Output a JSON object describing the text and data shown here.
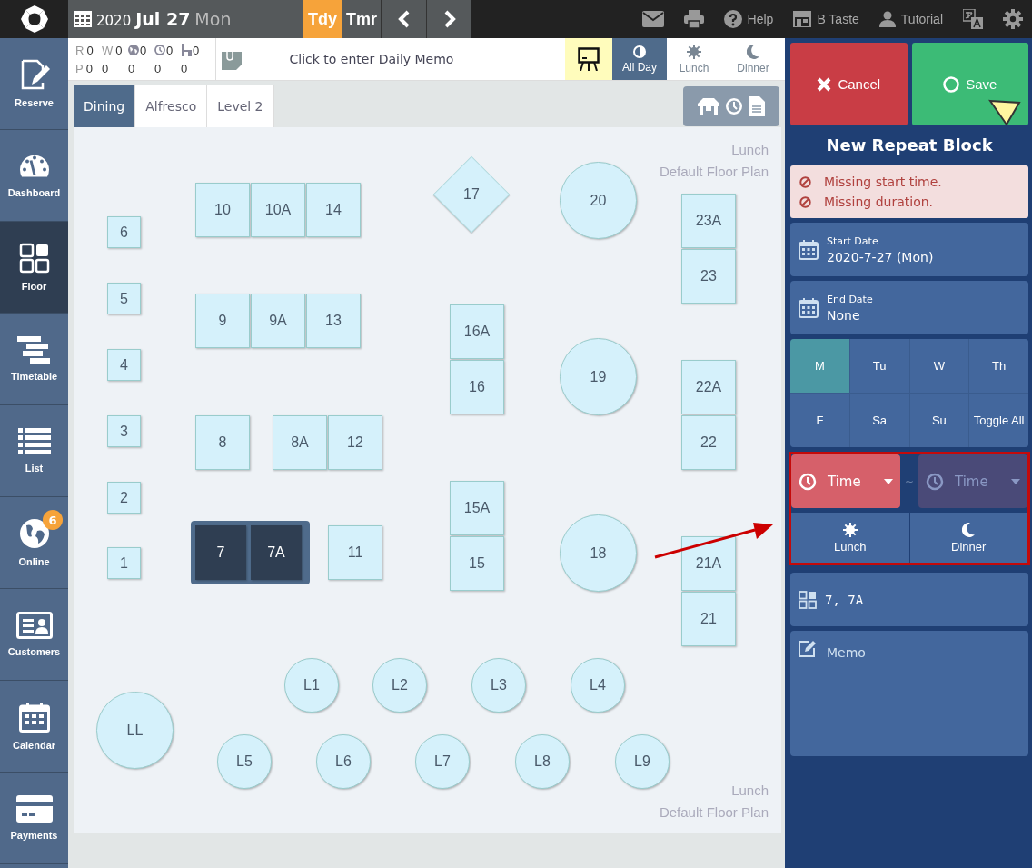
{
  "topbar": {
    "year": "2020",
    "date": "Jul 27",
    "weekday": "Mon",
    "day_buttons": [
      {
        "label": "Tdy",
        "selected": true
      },
      {
        "label": "Tmr",
        "selected": false
      }
    ],
    "links": [
      {
        "kind": "mail"
      },
      {
        "kind": "print"
      },
      {
        "kind": "help",
        "label": "Help"
      },
      {
        "kind": "store",
        "label": "B Taste"
      },
      {
        "kind": "person",
        "label": "Tutorial"
      },
      {
        "kind": "translate"
      },
      {
        "kind": "settings"
      }
    ]
  },
  "sidebar": {
    "items": [
      {
        "kind": "reserve",
        "label": "Reserve",
        "selected": false
      },
      {
        "kind": "dashboard",
        "label": "Dashboard",
        "selected": false
      },
      {
        "kind": "floor",
        "label": "Floor",
        "selected": true
      },
      {
        "kind": "timetable",
        "label": "Timetable",
        "selected": false
      },
      {
        "kind": "list",
        "label": "List",
        "selected": false
      },
      {
        "kind": "online",
        "label": "Online",
        "selected": false,
        "badge": "6"
      },
      {
        "kind": "customers",
        "label": "Customers",
        "selected": false
      },
      {
        "kind": "calendar",
        "label": "Calendar",
        "selected": false
      },
      {
        "kind": "payments",
        "label": "Payments",
        "selected": false
      }
    ]
  },
  "stats": {
    "top": [
      {
        "kind": "letter",
        "label": "R",
        "value": "0"
      },
      {
        "kind": "letter",
        "label": "W",
        "value": "0"
      },
      {
        "kind": "globe",
        "value": "0"
      },
      {
        "kind": "clock",
        "value": "0"
      },
      {
        "kind": "chair",
        "value": "0"
      }
    ],
    "bottom": {
      "label": "P",
      "values": [
        "0",
        "0",
        "0",
        "0",
        "0"
      ]
    }
  },
  "memo": {
    "placeholder": "Click to enter Daily Memo"
  },
  "services": [
    {
      "kind": "allday",
      "label": "All Day",
      "selected": true
    },
    {
      "kind": "lunch",
      "label": "Lunch",
      "selected": false
    },
    {
      "kind": "dinner",
      "label": "Dinner",
      "selected": false
    }
  ],
  "areas": [
    {
      "label": "Dining",
      "selected": true
    },
    {
      "label": "Alfresco",
      "selected": false
    },
    {
      "label": "Level 2",
      "selected": false
    }
  ],
  "floor": {
    "caption_top": [
      "Lunch",
      "Default Floor Plan"
    ],
    "caption_bottom": [
      "Lunch",
      "Default Floor Plan"
    ],
    "tables": [
      {
        "label": "6",
        "kind": "small",
        "selected": false
      },
      {
        "label": "5",
        "kind": "small",
        "selected": false
      },
      {
        "label": "4",
        "kind": "small",
        "selected": false
      },
      {
        "label": "3",
        "kind": "small",
        "selected": false
      },
      {
        "label": "2",
        "kind": "small",
        "selected": false
      },
      {
        "label": "1",
        "kind": "small",
        "selected": false
      },
      {
        "label": "10",
        "kind": "square",
        "selected": false
      },
      {
        "label": "10A",
        "kind": "square",
        "selected": false
      },
      {
        "label": "14",
        "kind": "square",
        "selected": false
      },
      {
        "label": "9",
        "kind": "square",
        "selected": false
      },
      {
        "label": "9A",
        "kind": "square",
        "selected": false
      },
      {
        "label": "13",
        "kind": "square",
        "selected": false
      },
      {
        "label": "8",
        "kind": "square",
        "selected": false
      },
      {
        "label": "8A",
        "kind": "square",
        "selected": false
      },
      {
        "label": "12",
        "kind": "square",
        "selected": false
      },
      {
        "label": "7",
        "kind": "square",
        "selected": true
      },
      {
        "label": "7A",
        "kind": "square",
        "selected": true
      },
      {
        "label": "11",
        "kind": "square",
        "selected": false
      },
      {
        "label": "17",
        "kind": "diamond",
        "selected": false
      },
      {
        "label": "20",
        "kind": "round",
        "selected": false
      },
      {
        "label": "19",
        "kind": "round",
        "selected": false
      },
      {
        "label": "18",
        "kind": "round",
        "selected": false
      },
      {
        "label": "16A",
        "kind": "square",
        "selected": false
      },
      {
        "label": "16",
        "kind": "square",
        "selected": false
      },
      {
        "label": "15A",
        "kind": "square",
        "selected": false
      },
      {
        "label": "15",
        "kind": "square",
        "selected": false
      },
      {
        "label": "23A",
        "kind": "square",
        "selected": false
      },
      {
        "label": "23",
        "kind": "square",
        "selected": false
      },
      {
        "label": "22A",
        "kind": "square",
        "selected": false
      },
      {
        "label": "22",
        "kind": "square",
        "selected": false
      },
      {
        "label": "21A",
        "kind": "square",
        "selected": false
      },
      {
        "label": "21",
        "kind": "square",
        "selected": false
      },
      {
        "label": "L1",
        "kind": "round",
        "selected": false
      },
      {
        "label": "L2",
        "kind": "round",
        "selected": false
      },
      {
        "label": "L3",
        "kind": "round",
        "selected": false
      },
      {
        "label": "L4",
        "kind": "round",
        "selected": false
      },
      {
        "label": "LL",
        "kind": "round",
        "selected": false
      },
      {
        "label": "L5",
        "kind": "round",
        "selected": false
      },
      {
        "label": "L6",
        "kind": "round",
        "selected": false
      },
      {
        "label": "L7",
        "kind": "round",
        "selected": false
      },
      {
        "label": "L8",
        "kind": "round",
        "selected": false
      },
      {
        "label": "L9",
        "kind": "round",
        "selected": false
      }
    ]
  },
  "panel": {
    "cancel": "Cancel",
    "save": "Save",
    "title": "New Repeat Block",
    "errors": [
      "Missing start time.",
      "Missing duration."
    ],
    "start_date": {
      "label": "Start Date",
      "value": "2020-7-27 (Mon)"
    },
    "end_date": {
      "label": "End Date",
      "value": "None"
    },
    "days": [
      {
        "label": "M",
        "selected": true
      },
      {
        "label": "Tu",
        "selected": false
      },
      {
        "label": "W",
        "selected": false
      },
      {
        "label": "Th",
        "selected": false
      },
      {
        "label": "F",
        "selected": false
      },
      {
        "label": "Sa",
        "selected": false
      },
      {
        "label": "Su",
        "selected": false
      }
    ],
    "toggle_all": "Toggle All",
    "time_fields": [
      {
        "placeholder": "Time",
        "invalid": true,
        "disabled": false
      },
      {
        "placeholder": "Time",
        "invalid": false,
        "disabled": true
      }
    ],
    "time_separator": "~",
    "service_buttons": [
      {
        "kind": "lunch",
        "label": "Lunch"
      },
      {
        "kind": "dinner",
        "label": "Dinner"
      }
    ],
    "tables_value": "7, 7A",
    "memo_placeholder": "Memo"
  }
}
